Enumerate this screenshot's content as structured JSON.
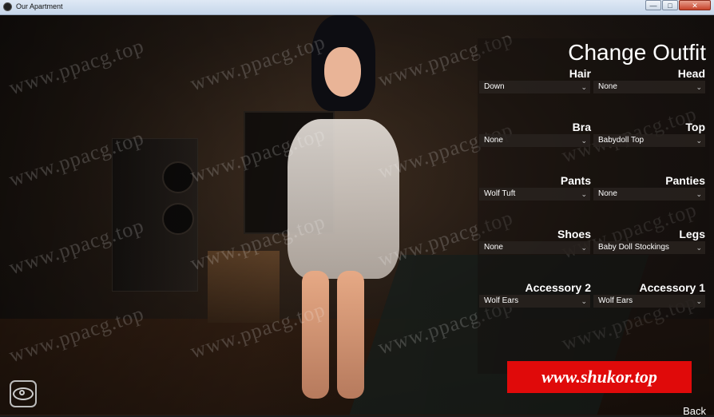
{
  "window": {
    "title": "Our Apartment",
    "buttons": [
      "—",
      "□",
      "✕"
    ]
  },
  "panel": {
    "title": "Change Outfit",
    "slots": [
      {
        "label": "Hair",
        "value": "Down"
      },
      {
        "label": "Head",
        "value": "None"
      },
      {
        "label": "Bra",
        "value": "None"
      },
      {
        "label": "Top",
        "value": "Babydoll Top"
      },
      {
        "label": "Pants",
        "value": "Wolf Tuft"
      },
      {
        "label": "Panties",
        "value": "None"
      },
      {
        "label": "Shoes",
        "value": "None"
      },
      {
        "label": "Legs",
        "value": "Baby Doll Stockings"
      },
      {
        "label": "Accessory 2",
        "value": "Wolf Ears"
      },
      {
        "label": "Accessory 1",
        "value": "Wolf Ears"
      }
    ],
    "chevron": "⌄"
  },
  "watermark_text": "www.ppacg.top",
  "banner_text": "www.shukor.top",
  "back_label": "Back",
  "icons": {
    "view_toggle": "eye-icon",
    "app": "app-icon"
  }
}
